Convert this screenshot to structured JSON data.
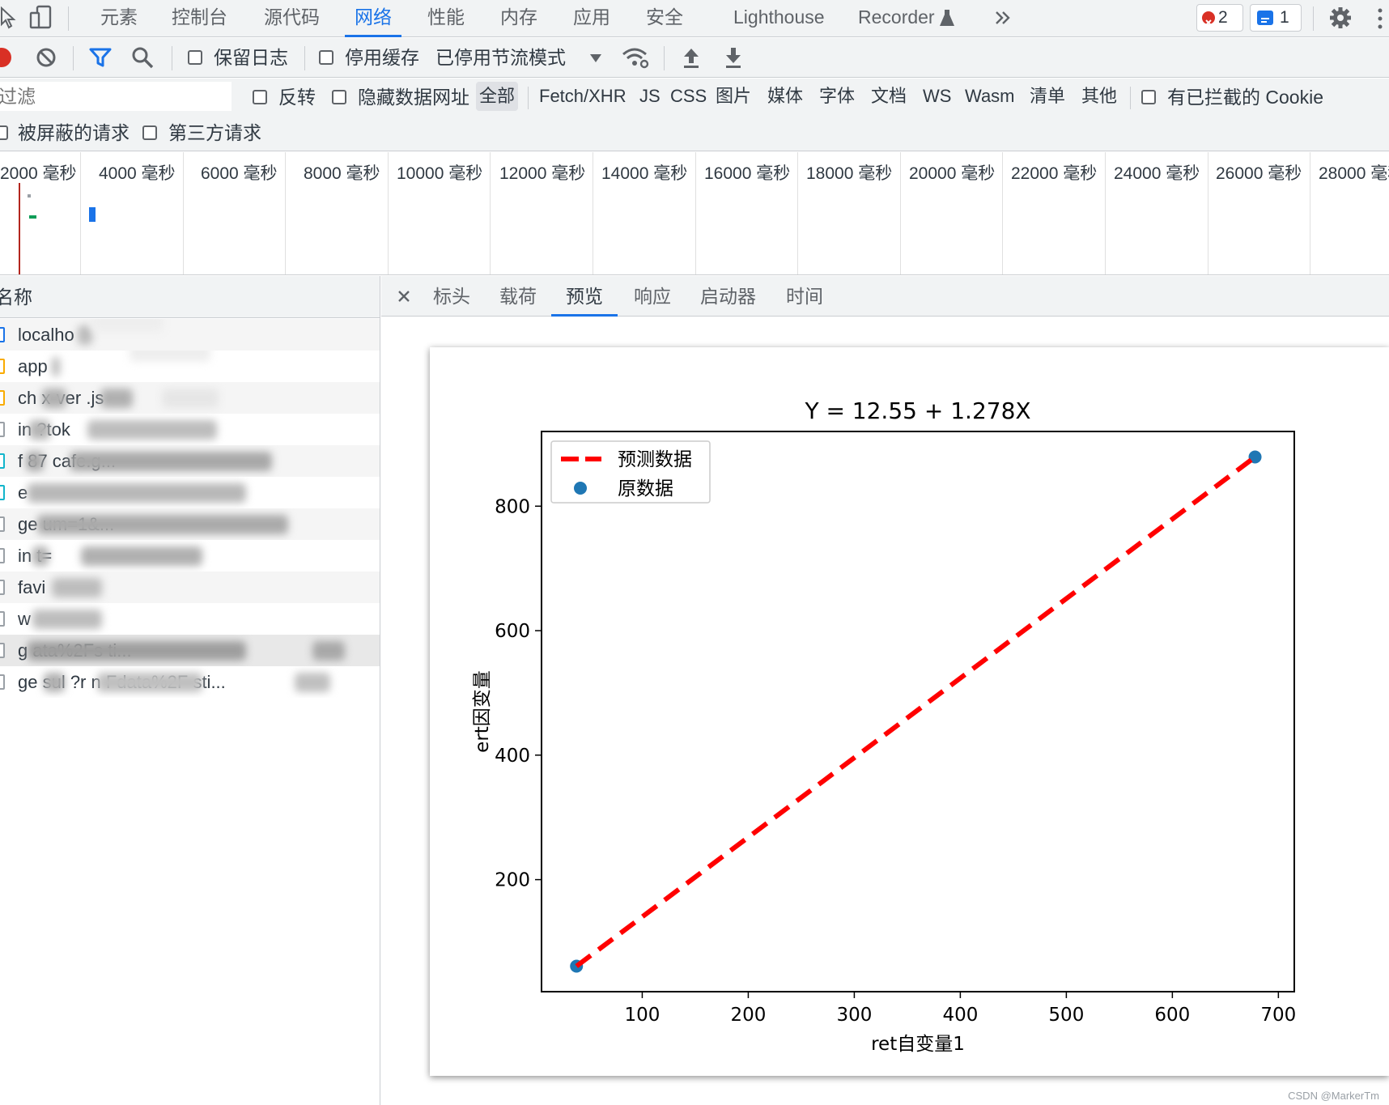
{
  "top_tabs": [
    "元素",
    "控制台",
    "源代码",
    "网络",
    "性能",
    "内存",
    "应用",
    "安全",
    "Lighthouse",
    "Recorder"
  ],
  "active_top_tab": "网络",
  "badges": {
    "errors": "2",
    "messages": "1"
  },
  "toolbar": {
    "preserve_log": "保留日志",
    "disable_cache": "停用缓存",
    "throttling": "已停用节流模式"
  },
  "filter": {
    "placeholder": "过滤",
    "invert": "反转",
    "hide_data_urls": "隐藏数据网址",
    "types": [
      "全部",
      "Fetch/XHR",
      "JS",
      "CSS",
      "图片",
      "媒体",
      "字体",
      "文档",
      "WS",
      "Wasm",
      "清单",
      "其他"
    ],
    "active_type": "全部",
    "blocked_cookies": "有已拦截的 Cookie",
    "blocked_requests": "被屏蔽的请求",
    "third_party": "第三方请求"
  },
  "timeline": {
    "ticks": [
      "2000 毫秒",
      "4000 毫秒",
      "6000 毫秒",
      "8000 毫秒",
      "10000 毫秒",
      "12000 毫秒",
      "14000 毫秒",
      "16000 毫秒",
      "18000 毫秒",
      "20000 毫秒",
      "22000 毫秒",
      "24000 毫秒",
      "26000 毫秒",
      "28000 毫秒"
    ]
  },
  "requests": {
    "header": "名称",
    "rows": [
      {
        "name": "localho",
        "icon": "doc"
      },
      {
        "name": "app",
        "icon": "script"
      },
      {
        "name": "ch   x-ver     .js",
        "icon": "script"
      },
      {
        "name": "in  ?tok",
        "icon": "doc"
      },
      {
        "name": "f  87                         cafe.g...",
        "icon": "image"
      },
      {
        "name": "e",
        "icon": "image"
      },
      {
        "name": "ge                            um=1&...",
        "icon": "doc"
      },
      {
        "name": "in   t=",
        "icon": "doc"
      },
      {
        "name": "favi",
        "icon": "doc"
      },
      {
        "name": "w",
        "icon": "doc"
      },
      {
        "name": "g                          ata%2Fs     ti...",
        "icon": "doc"
      },
      {
        "name": "ge   sul   ?r        n        Fdata%2F    sti...",
        "icon": "doc"
      }
    ]
  },
  "detail_tabs": [
    "标头",
    "载荷",
    "预览",
    "响应",
    "启动器",
    "时间"
  ],
  "active_detail_tab": "预览",
  "watermark": "CSDN @MarkerTm",
  "colors": {
    "accent": "#1a73e8",
    "line": "#ff0000",
    "points": "#1f77b4",
    "error": "#d93025"
  },
  "chart_data": {
    "type": "scatter",
    "title": "Y = 12.55 + 1.278X",
    "xlabel": "ret自变量1",
    "ylabel": "ert因变量",
    "xlim": [
      5,
      715
    ],
    "ylim": [
      20,
      920
    ],
    "xticks": [
      100,
      200,
      300,
      400,
      500,
      600,
      700
    ],
    "yticks": [
      200,
      400,
      600,
      800
    ],
    "legend_position": "upper-left",
    "series": [
      {
        "name": "预测数据",
        "kind": "line",
        "style": "dashed",
        "color": "#ff0000",
        "x": [
          38,
          678
        ],
        "y": [
          61,
          879
        ]
      },
      {
        "name": "原数据",
        "kind": "scatter",
        "color": "#1f77b4",
        "x": [
          38,
          678
        ],
        "y": [
          61,
          879
        ]
      }
    ]
  }
}
